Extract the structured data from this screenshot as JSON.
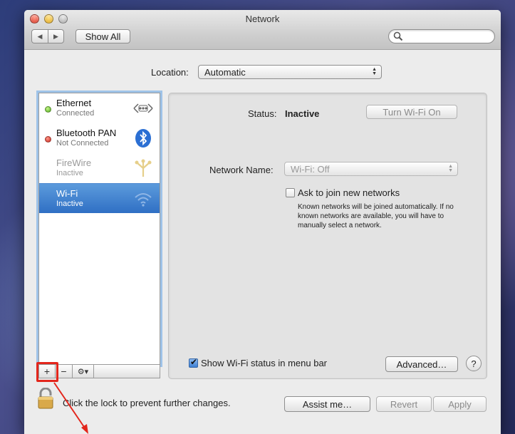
{
  "window": {
    "title": "Network"
  },
  "toolbar": {
    "show_all_label": "Show All",
    "search_placeholder": ""
  },
  "location": {
    "label": "Location:",
    "value": "Automatic"
  },
  "services": [
    {
      "name": "Ethernet",
      "status": "Connected",
      "dot": "green",
      "icon": "ethernet-icon"
    },
    {
      "name": "Bluetooth PAN",
      "status": "Not Connected",
      "dot": "red",
      "icon": "bluetooth-icon"
    },
    {
      "name": "FireWire",
      "status": "Inactive",
      "dot": "none",
      "icon": "firewire-icon"
    },
    {
      "name": "Wi-Fi",
      "status": "Inactive",
      "dot": "none",
      "icon": "wifi-icon",
      "selected": true
    }
  ],
  "sidebar_toolbar": {
    "add": "+",
    "remove": "−",
    "gear": "⚙▾"
  },
  "detail": {
    "status_label": "Status:",
    "status_value": "Inactive",
    "turn_on_label": "Turn Wi-Fi On",
    "network_name_label": "Network Name:",
    "network_name_value": "Wi-Fi: Off",
    "ask_label": "Ask to join new networks",
    "ask_checked": false,
    "ask_desc": "Known networks will be joined automatically. If no known networks are available, you will have to manually select a network.",
    "show_status_label": "Show Wi-Fi status in menu bar",
    "show_status_checked": true,
    "advanced_label": "Advanced…",
    "help_label": "?"
  },
  "footer": {
    "lock_text": "Click the lock to prevent further changes.",
    "assist_label": "Assist me…",
    "revert_label": "Revert",
    "apply_label": "Apply"
  },
  "colors": {
    "selection": "#2f6fc4",
    "highlight": "#e3261c"
  }
}
